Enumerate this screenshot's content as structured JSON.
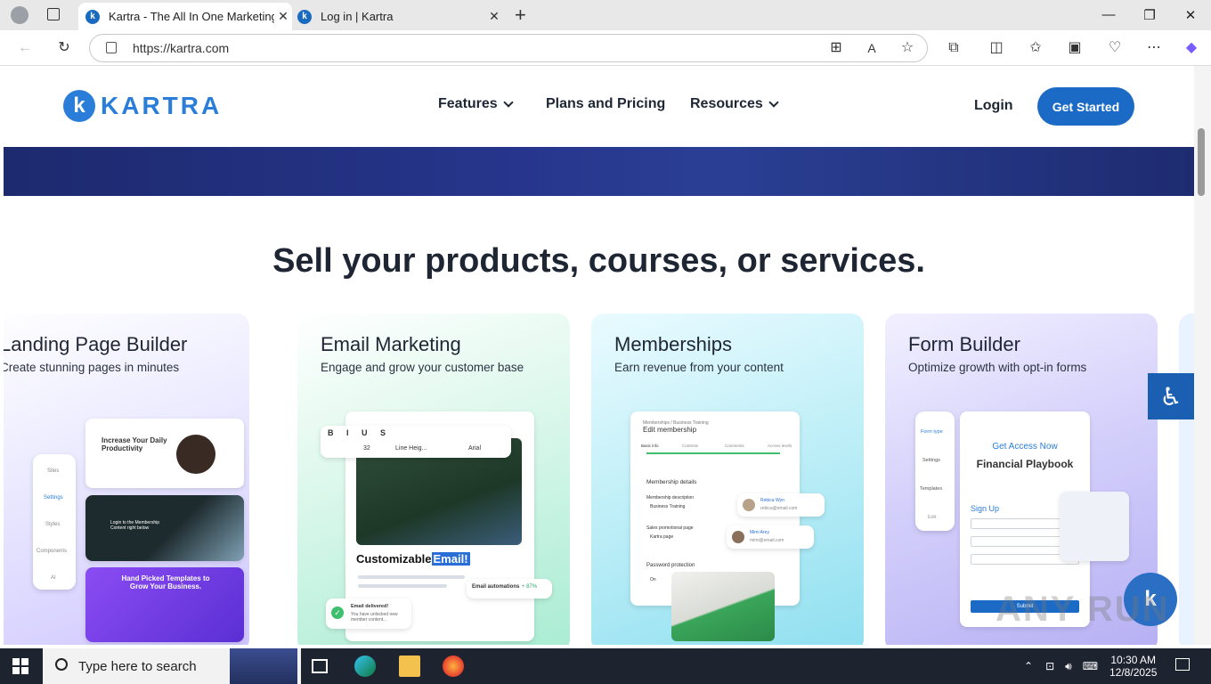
{
  "browser": {
    "tabs": [
      {
        "title": "Kartra - The All In One Marketing",
        "active": true
      },
      {
        "title": "Log in | Kartra",
        "active": false
      }
    ],
    "new_tab": "+",
    "url": "https://kartra.com",
    "window_controls": {
      "minimize": "—",
      "restore": "❐",
      "close": "✕"
    }
  },
  "site": {
    "logo_text": "KARTRA",
    "logo_mark": "k",
    "nav": [
      {
        "label": "Features",
        "has_dropdown": true
      },
      {
        "label": "Plans and Pricing",
        "has_dropdown": false
      },
      {
        "label": "Resources",
        "has_dropdown": true
      }
    ],
    "login": "Login",
    "cta": "Get Started",
    "headline": "Sell your products, courses, or services.",
    "cards": [
      {
        "title": "Landing Page Builder",
        "subtitle": "Create stunning pages in minutes",
        "mock": {
          "menu": [
            "Sites",
            "Settings",
            "Styles",
            "Components",
            "AI"
          ],
          "hero_title": "Increase Your Daily Productivity",
          "membership_title": "Login to the Membership Content right below",
          "templates_title": "Hand Picked Templates to Grow Your Business."
        }
      },
      {
        "title": "Email Marketing",
        "subtitle": "Engage and grow your customer base",
        "mock": {
          "font_size": "32",
          "line_height": "Line Heig...",
          "font": "Arial",
          "caption_plain": "Customizable",
          "caption_highlight": "Email!",
          "automation_label": "Email automations",
          "automation_value": "+ 87%",
          "delivered_title": "Email delivered!",
          "delivered_text": "You have unlocked new member content..."
        }
      },
      {
        "title": "Memberships",
        "subtitle": "Earn revenue from your content",
        "mock": {
          "breadcrumb": "Memberships / Business Training",
          "heading": "Edit membership",
          "steps": [
            "Basic info",
            "Contents",
            "Comments",
            "Access levels"
          ],
          "details_title": "Membership details",
          "description_label": "Membership description",
          "description_value": "Business Training",
          "promo_label": "Sales promotional page",
          "promo_value": "Kartra page",
          "password_label": "Password protection",
          "password_value": "On",
          "users": [
            {
              "name": "Rebica Wyn",
              "email": "rebica@email.com"
            },
            {
              "name": "Mimi Arey",
              "email": "mimi@email.com"
            }
          ]
        }
      },
      {
        "title": "Form Builder",
        "subtitle": "Optimize growth with opt-in forms",
        "mock": {
          "menu": [
            "Form type",
            "Settings",
            "Templates",
            "Edit"
          ],
          "eyebrow": "Get Access Now",
          "form_title": "Financial Playbook",
          "signup": "Sign Up",
          "submit": "Submit"
        }
      }
    ]
  },
  "overlays": {
    "watermark": "ANY RUN"
  },
  "taskbar": {
    "search_placeholder": "Type here to search",
    "time": "10:30 AM",
    "date": "12/8/2025"
  },
  "colors": {
    "brand_blue": "#1b6bc6",
    "hero_band": "#26348a",
    "text_dark": "#1f2633"
  }
}
